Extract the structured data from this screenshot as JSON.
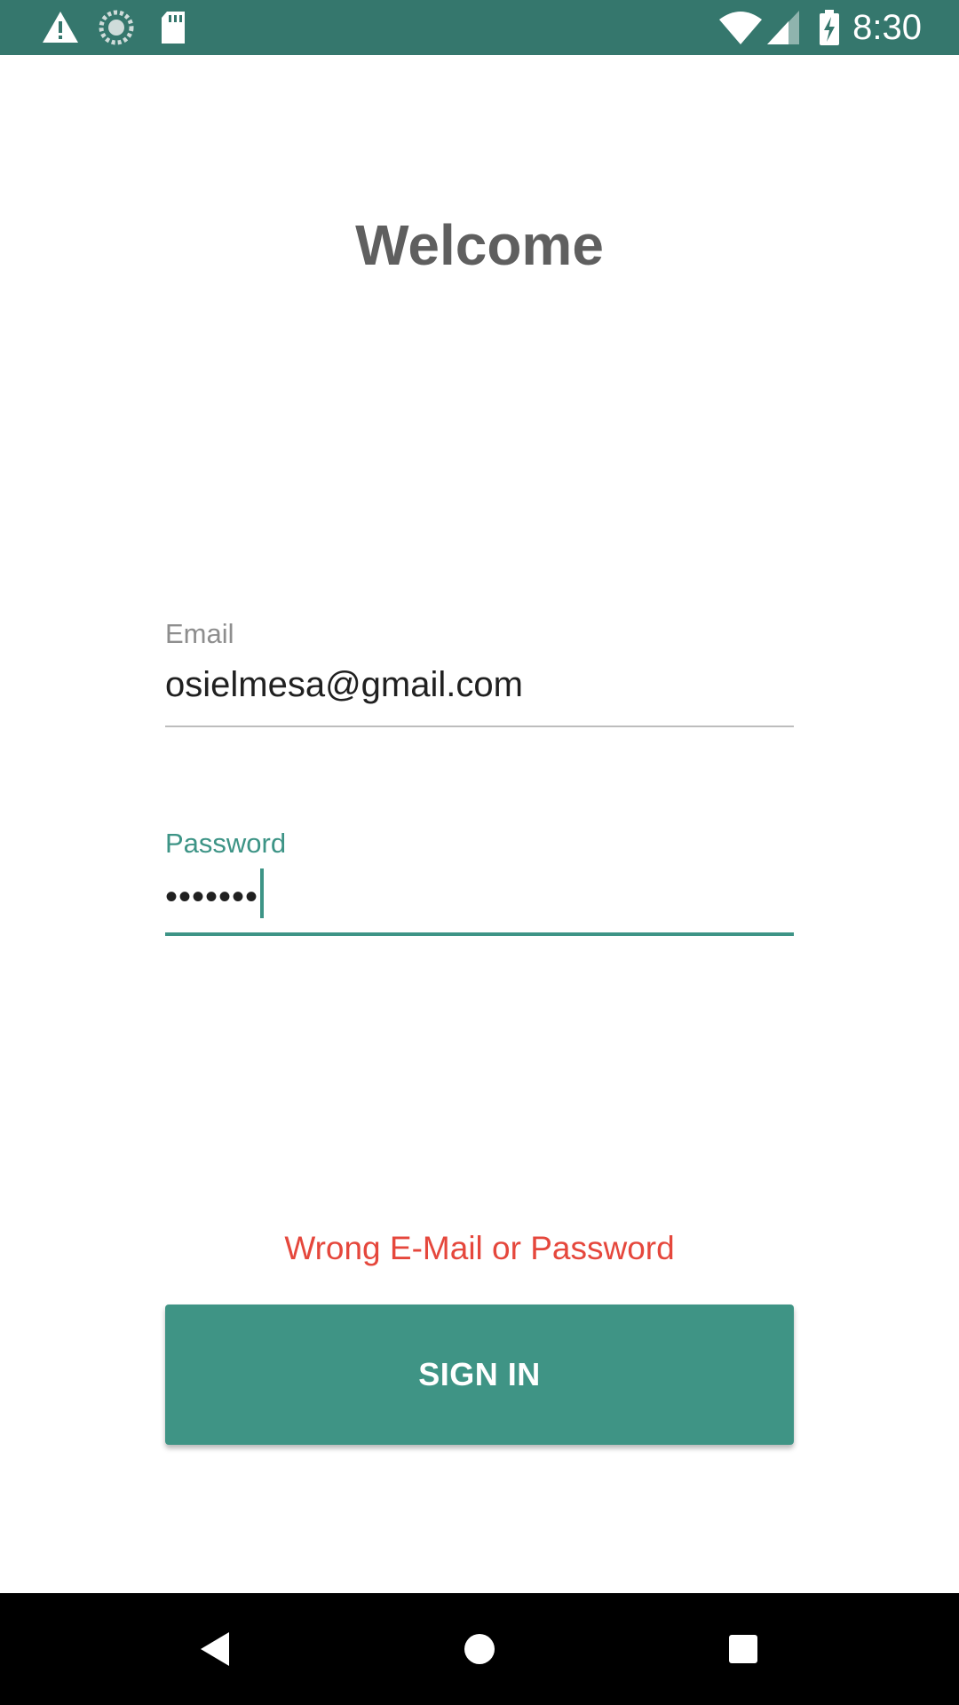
{
  "status_bar": {
    "time": "8:30",
    "icons": [
      "warning-icon",
      "sync-icon",
      "sd-card-icon",
      "wifi-icon",
      "signal-icon",
      "battery-charging-icon"
    ]
  },
  "welcome": {
    "title": "Welcome"
  },
  "email": {
    "label": "Email",
    "value": "osielmesa@gmail.com"
  },
  "password": {
    "label": "Password",
    "masked_value": "•••••••"
  },
  "error_message": "Wrong E-Mail or Password",
  "sign_in_button": {
    "label": "SIGN IN"
  },
  "colors": {
    "status_bar": "#35776d",
    "accent": "#3d9486",
    "error": "#e5473c",
    "title": "#5f5f5f"
  },
  "nav_bar": {
    "buttons": [
      "back-icon",
      "home-icon",
      "recents-icon"
    ]
  }
}
